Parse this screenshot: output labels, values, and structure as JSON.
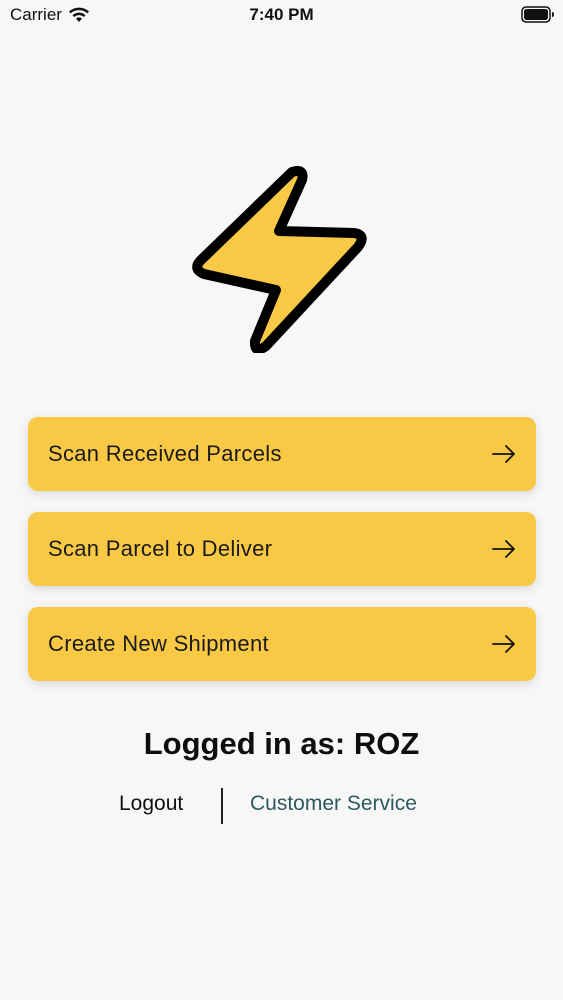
{
  "status_bar": {
    "carrier": "Carrier",
    "time": "7:40 PM"
  },
  "logo": {
    "icon": "lightning-bolt-icon",
    "color": "#f9c946",
    "outline_color": "#000000"
  },
  "actions": [
    {
      "label": "Scan Received Parcels",
      "icon": "arrow-right-icon"
    },
    {
      "label": "Scan Parcel to Deliver",
      "icon": "arrow-right-icon"
    },
    {
      "label": "Create New Shipment",
      "icon": "arrow-right-icon"
    }
  ],
  "session": {
    "logged_in_text": "Logged in as: ROZ"
  },
  "footer": {
    "logout_label": "Logout",
    "customer_service_label": "Customer Service"
  },
  "colors": {
    "accent": "#f9c946",
    "link": "#2e5a5f",
    "background": "#f7f7f8"
  }
}
